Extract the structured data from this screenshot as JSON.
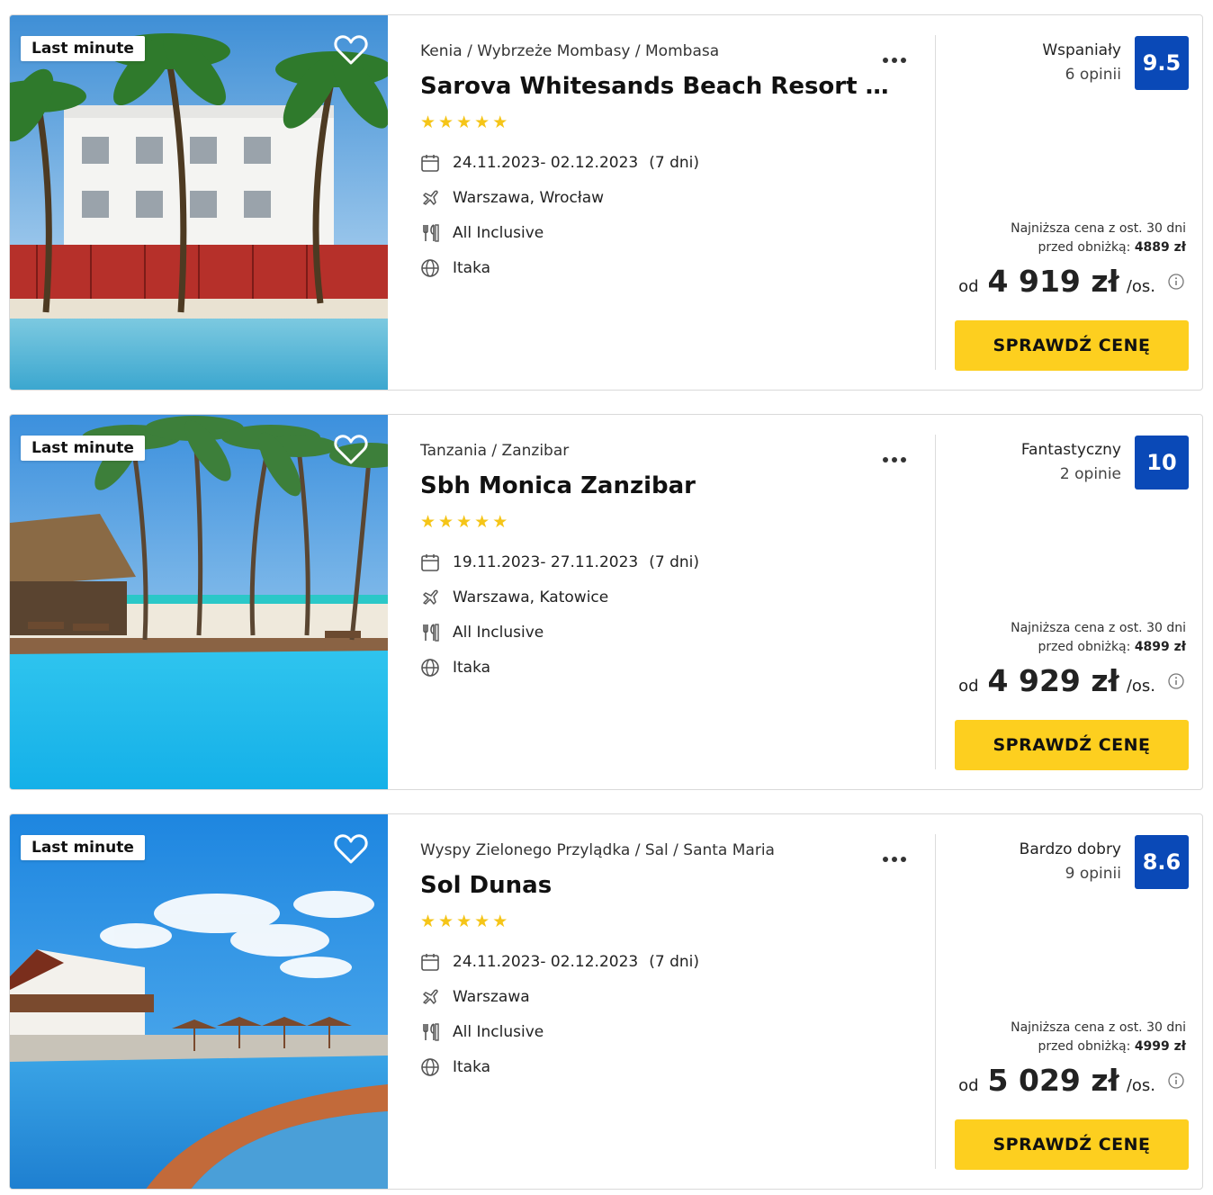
{
  "offers": [
    {
      "badge": "Last minute",
      "location": "Kenia / Wybrzeże Mombasy / Mombasa",
      "name": "Sarova Whitesands Beach Resort & S...",
      "stars": 5,
      "dates": "24.11.2023- 02.12.2023",
      "duration": "(7 dni)",
      "departure": "Warszawa, Wrocław",
      "board": "All Inclusive",
      "operator": "Itaka",
      "rating_label": "Wspaniały",
      "reviews": "6 opinii",
      "score": "9.5",
      "lowest_price_line1": "Najniższa cena z ost. 30 dni",
      "lowest_price_prefix": "przed obniżką:",
      "lowest_price_value": "4889 zł",
      "price_from": "od",
      "price": "4 919 zł",
      "price_unit": "/os.",
      "cta": "SPRAWDŹ CENĘ"
    },
    {
      "badge": "Last minute",
      "location": "Tanzania / Zanzibar",
      "name": "Sbh Monica Zanzibar",
      "stars": 5,
      "dates": "19.11.2023- 27.11.2023",
      "duration": "(7 dni)",
      "departure": "Warszawa, Katowice",
      "board": "All Inclusive",
      "operator": "Itaka",
      "rating_label": "Fantastyczny",
      "reviews": "2 opinie",
      "score": "10",
      "lowest_price_line1": "Najniższa cena z ost. 30 dni",
      "lowest_price_prefix": "przed obniżką:",
      "lowest_price_value": "4899 zł",
      "price_from": "od",
      "price": "4 929 zł",
      "price_unit": "/os.",
      "cta": "SPRAWDŹ CENĘ"
    },
    {
      "badge": "Last minute",
      "location": "Wyspy Zielonego Przylądka / Sal / Santa Maria",
      "name": "Sol Dunas",
      "stars": 5,
      "dates": "24.11.2023- 02.12.2023",
      "duration": "(7 dni)",
      "departure": "Warszawa",
      "board": "All Inclusive",
      "operator": "Itaka",
      "rating_label": "Bardzo dobry",
      "reviews": "9 opinii",
      "score": "8.6",
      "lowest_price_line1": "Najniższa cena z ost. 30 dni",
      "lowest_price_prefix": "przed obniżką:",
      "lowest_price_value": "4999 zł",
      "price_from": "od",
      "price": "5 029 zł",
      "price_unit": "/os.",
      "cta": "SPRAWDŹ CENĘ"
    }
  ],
  "colors": {
    "score_bg": "#0a49b7",
    "cta_bg": "#fdcf1f",
    "star": "#f5c518"
  },
  "icons": {
    "favorite": "heart-outline-icon",
    "more": "more-dots-icon",
    "dates": "calendar-icon",
    "departure": "plane-icon",
    "board": "cutlery-icon",
    "operator": "globe-icon",
    "price_info": "info-circle-icon"
  }
}
